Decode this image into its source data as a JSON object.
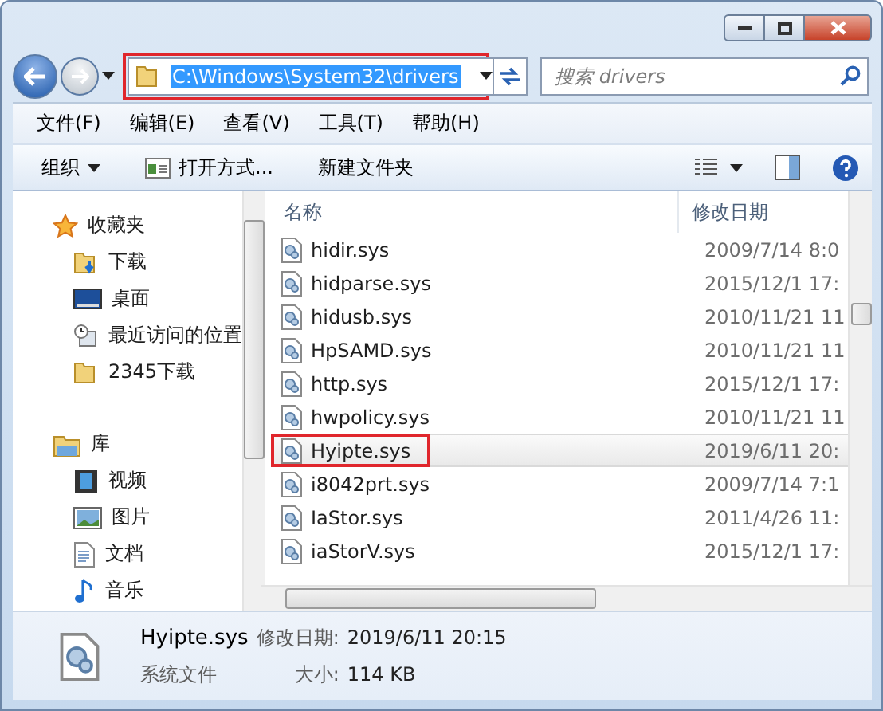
{
  "address_bar": {
    "path": "C:\\Windows\\System32\\drivers",
    "highlighted": true
  },
  "search": {
    "placeholder": "搜索 drivers"
  },
  "menu": [
    "文件(F)",
    "编辑(E)",
    "查看(V)",
    "工具(T)",
    "帮助(H)"
  ],
  "toolbar": [
    {
      "label": "组织",
      "kind": "dropdown"
    },
    {
      "label": "打开方式...",
      "kind": "icon"
    },
    {
      "label": "新建文件夹",
      "kind": "plain"
    }
  ],
  "sidebar": {
    "groups": [
      {
        "label": "收藏夹",
        "kind": "star",
        "children": [
          {
            "label": "下载",
            "kind": "download"
          },
          {
            "label": "桌面",
            "kind": "desktop"
          },
          {
            "label": "最近访问的位置",
            "kind": "recent"
          },
          {
            "label": "2345下载",
            "kind": "folder"
          }
        ]
      },
      {
        "label": "库",
        "kind": "library",
        "children": [
          {
            "label": "视频",
            "kind": "video"
          },
          {
            "label": "图片",
            "kind": "picture"
          },
          {
            "label": "文档",
            "kind": "document"
          },
          {
            "label": "音乐",
            "kind": "music"
          }
        ]
      }
    ]
  },
  "table": {
    "columns": [
      "名称",
      "修改日期"
    ],
    "rows": [
      {
        "name": "hidir.sys",
        "date": "2009/7/14 8:0",
        "selected": false,
        "highlighted": false
      },
      {
        "name": "hidparse.sys",
        "date": "2015/12/1 17:",
        "selected": false,
        "highlighted": false
      },
      {
        "name": "hidusb.sys",
        "date": "2010/11/21 11",
        "selected": false,
        "highlighted": false
      },
      {
        "name": "HpSAMD.sys",
        "date": "2010/11/21 11",
        "selected": false,
        "highlighted": false
      },
      {
        "name": "http.sys",
        "date": "2015/12/1 17:",
        "selected": false,
        "highlighted": false
      },
      {
        "name": "hwpolicy.sys",
        "date": "2010/11/21 11",
        "selected": false,
        "highlighted": false
      },
      {
        "name": "Hyipte.sys",
        "date": "2019/6/11 20:",
        "selected": true,
        "highlighted": true
      },
      {
        "name": "i8042prt.sys",
        "date": "2009/7/14 7:1",
        "selected": false,
        "highlighted": false
      },
      {
        "name": "IaStor.sys",
        "date": "2011/4/26 11:",
        "selected": false,
        "highlighted": false
      },
      {
        "name": "iaStorV.sys",
        "date": "2015/12/1 17:",
        "selected": false,
        "highlighted": false
      }
    ]
  },
  "details": {
    "name": "Hyipte.sys",
    "type": "系统文件",
    "date_label": "修改日期:",
    "date": "2019/6/11 20:15",
    "size_label": "大小:",
    "size": "114 KB"
  }
}
